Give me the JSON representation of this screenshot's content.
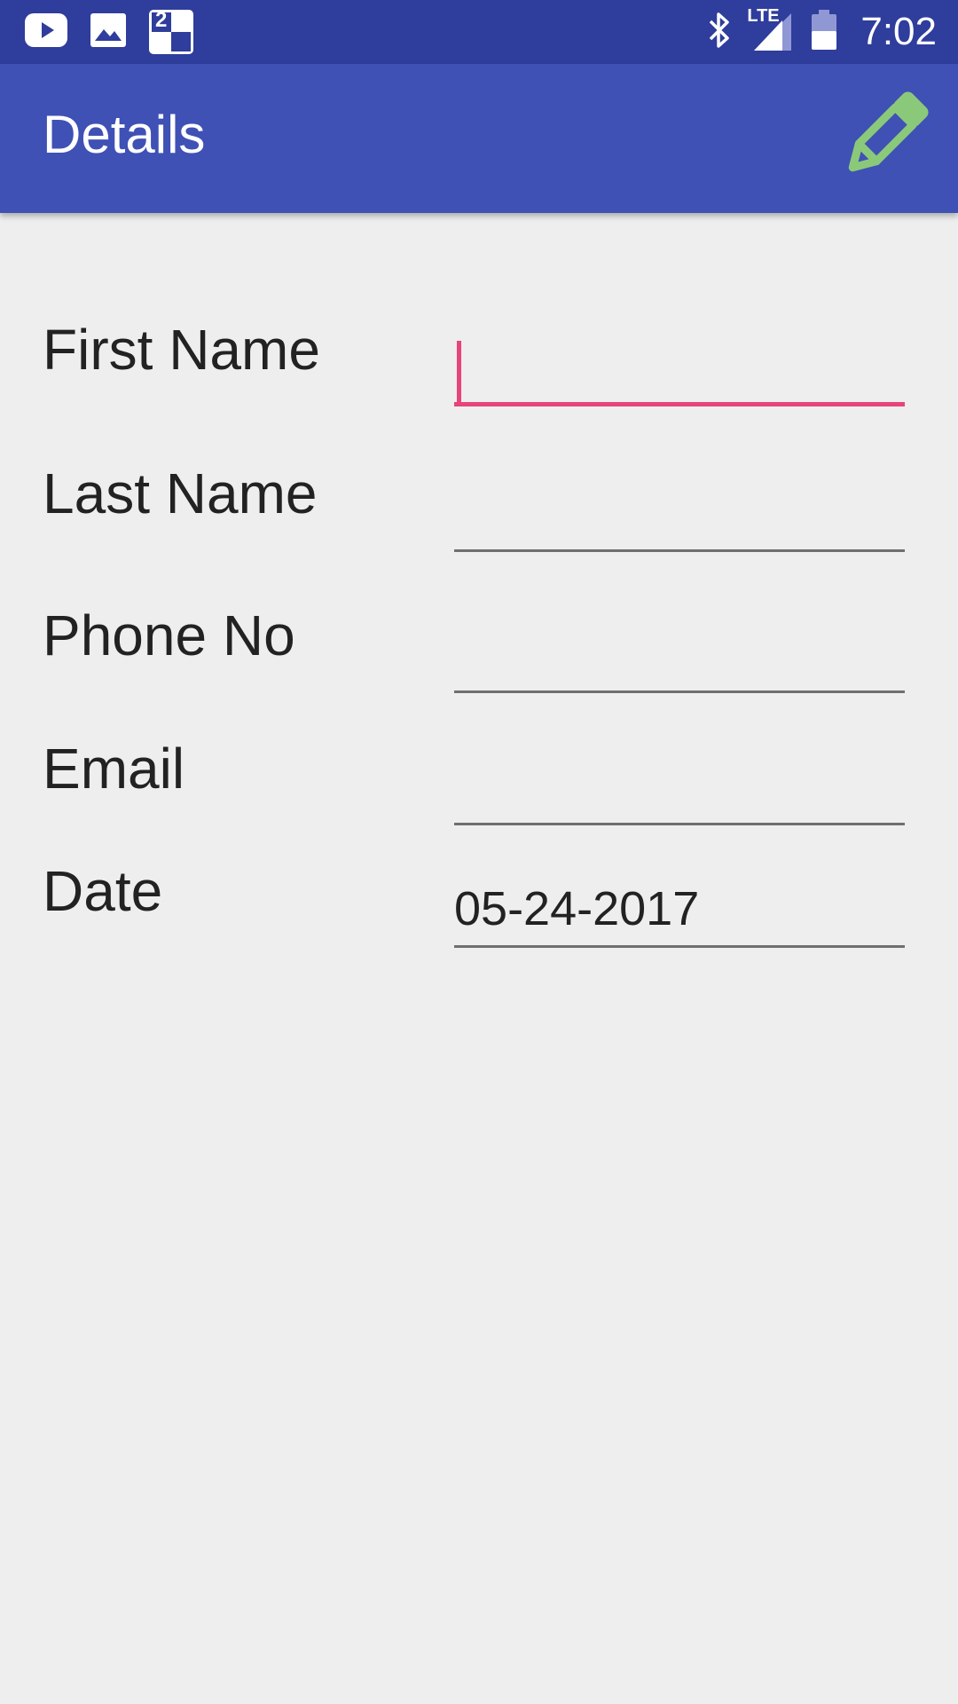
{
  "status_bar": {
    "time": "7:02",
    "network_label": "LTE",
    "notification_icons": [
      "youtube-icon",
      "gallery-icon",
      "chess-app-icon"
    ],
    "chess_badge": "2",
    "system_icons": [
      "bluetooth-icon",
      "signal-icon",
      "battery-icon"
    ]
  },
  "app_bar": {
    "title": "Details",
    "edit_icon": "pencil-icon",
    "edit_icon_color": "#8bc97a"
  },
  "form": {
    "fields": [
      {
        "label": "First Name",
        "value": "",
        "focused": true
      },
      {
        "label": "Last Name",
        "value": ""
      },
      {
        "label": "Phone No",
        "value": ""
      },
      {
        "label": "Email",
        "value": ""
      },
      {
        "label": "Date",
        "value": "05-24-2017"
      }
    ]
  },
  "colors": {
    "status_bar": "#2f3d9c",
    "app_bar": "#3f51b5",
    "accent": "#e8437b",
    "background": "#eeeeee"
  }
}
